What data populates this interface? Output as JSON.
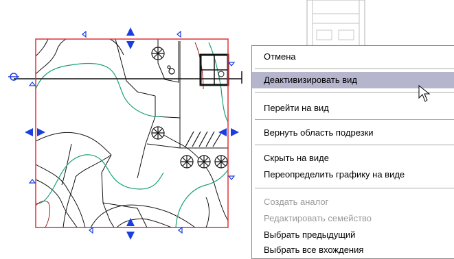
{
  "context_menu": {
    "items": [
      {
        "label": "Отмена",
        "state": "normal"
      },
      {
        "label": "Деактивизировать вид",
        "state": "highlighted"
      },
      {
        "label": "Перейти на вид",
        "state": "normal"
      },
      {
        "label": "Вернуть область подрезки",
        "state": "normal"
      },
      {
        "label": "Скрыть на виде",
        "state": "normal"
      },
      {
        "label": "Переопределить графику на виде",
        "state": "normal"
      },
      {
        "label": "Создать аналог",
        "state": "disabled"
      },
      {
        "label": "Редактировать семейство",
        "state": "disabled"
      },
      {
        "label": "Выбрать предыдущий",
        "state": "normal"
      },
      {
        "label": "Выбрать все вхождения",
        "state": "normal"
      }
    ]
  },
  "colors": {
    "crop_boundary": "#e0303a",
    "grip_arrows": "#1a3ee0",
    "contour_green": "#18a078",
    "contour_red": "#a02020",
    "menu_highlight": "#b5b5ce"
  },
  "icons": [
    "mouse-pointer-icon",
    "tree-symbol-icon",
    "grip-arrow-icon",
    "section-marker-icon"
  ]
}
